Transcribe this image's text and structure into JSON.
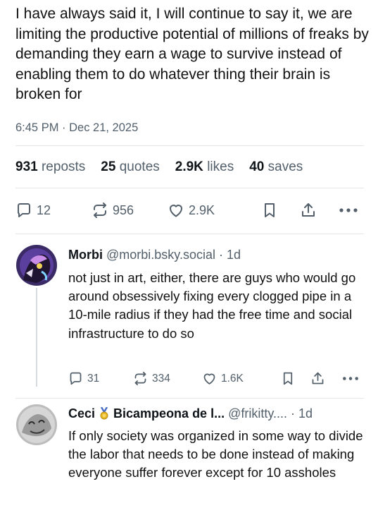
{
  "post": {
    "text": "I have always said it, I will continue to say it, we are limiting the productive potential of millions of freaks by demanding they earn a wage to survive instead of enabling them to do whatever thing their brain is broken for",
    "timestamp": "6:45 PM · Dec 21, 2025",
    "stats": {
      "reposts_count": "931",
      "reposts_label": "reposts",
      "quotes_count": "25",
      "quotes_label": "quotes",
      "likes_count": "2.9K",
      "likes_label": "likes",
      "saves_count": "40",
      "saves_label": "saves"
    },
    "actions": {
      "replies": "12",
      "reposts": "956",
      "likes": "2.9K"
    }
  },
  "replies": [
    {
      "name": "Morbi",
      "handle": "@morbi.bsky.social",
      "time": "· 1d",
      "text": "not just in art, either, there are guys who would go around obsessively fixing every clogged pipe in a 10-mile radius if they had the free time and social infrastructure to do so",
      "replies": "31",
      "reposts": "334",
      "likes": "1.6K"
    },
    {
      "name": "Ceci",
      "name_suffix": "Bicampeona de l...",
      "handle": "@frikitty....",
      "time": "· 1d",
      "text": "If only society was organized in some way to divide the labor that needs to be done instead of making everyone suffer forever except for 10 assholes"
    }
  ],
  "icons": {
    "reply": "speech-bubble-icon",
    "repost": "repost-arrows-icon",
    "like": "heart-icon",
    "save": "bookmark-icon",
    "share": "share-upload-icon",
    "more": "ellipsis-icon",
    "medal": "gold-medal-icon"
  },
  "colors": {
    "text": "#0f1419",
    "secondary": "#53606b",
    "divider": "#e3e6e8"
  }
}
